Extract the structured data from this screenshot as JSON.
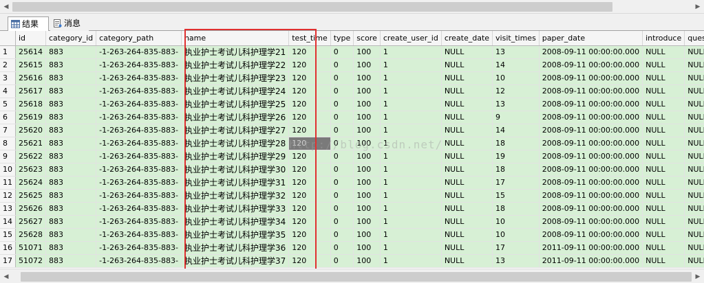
{
  "tabs": {
    "results_label": "结果",
    "messages_label": "消息"
  },
  "grid": {
    "columns": [
      "id",
      "category_id",
      "category_path",
      "name",
      "test_time",
      "type",
      "score",
      "create_user_id",
      "create_date",
      "visit_times",
      "paper_date",
      "introduce",
      "questio"
    ],
    "rows": [
      {
        "n": "1",
        "cells": [
          "25614",
          "883",
          "-1-263-264-835-883-",
          "执业护士考试儿科护理学21",
          "120",
          "0",
          "100",
          "1",
          "NULL",
          "13",
          "2008-09-11 00:00:00.000",
          "NULL",
          "NULL"
        ]
      },
      {
        "n": "2",
        "cells": [
          "25615",
          "883",
          "-1-263-264-835-883-",
          "执业护士考试儿科护理学22",
          "120",
          "0",
          "100",
          "1",
          "NULL",
          "14",
          "2008-09-11 00:00:00.000",
          "NULL",
          "NULL"
        ]
      },
      {
        "n": "3",
        "cells": [
          "25616",
          "883",
          "-1-263-264-835-883-",
          "执业护士考试儿科护理学23",
          "120",
          "0",
          "100",
          "1",
          "NULL",
          "10",
          "2008-09-11 00:00:00.000",
          "NULL",
          "NULL"
        ]
      },
      {
        "n": "4",
        "cells": [
          "25617",
          "883",
          "-1-263-264-835-883-",
          "执业护士考试儿科护理学24",
          "120",
          "0",
          "100",
          "1",
          "NULL",
          "12",
          "2008-09-11 00:00:00.000",
          "NULL",
          "NULL"
        ]
      },
      {
        "n": "5",
        "cells": [
          "25618",
          "883",
          "-1-263-264-835-883-",
          "执业护士考试儿科护理学25",
          "120",
          "0",
          "100",
          "1",
          "NULL",
          "13",
          "2008-09-11 00:00:00.000",
          "NULL",
          "NULL"
        ]
      },
      {
        "n": "6",
        "cells": [
          "25619",
          "883",
          "-1-263-264-835-883-",
          "执业护士考试儿科护理学26",
          "120",
          "0",
          "100",
          "1",
          "NULL",
          "9",
          "2008-09-11 00:00:00.000",
          "NULL",
          "NULL"
        ]
      },
      {
        "n": "7",
        "cells": [
          "25620",
          "883",
          "-1-263-264-835-883-",
          "执业护士考试儿科护理学27",
          "120",
          "0",
          "100",
          "1",
          "NULL",
          "14",
          "2008-09-11 00:00:00.000",
          "NULL",
          "NULL"
        ]
      },
      {
        "n": "8",
        "cells": [
          "25621",
          "883",
          "-1-263-264-835-883-",
          "执业护士考试儿科护理学28",
          "120",
          "0",
          "100",
          "1",
          "NULL",
          "18",
          "2008-09-11 00:00:00.000",
          "NULL",
          "NULL"
        ]
      },
      {
        "n": "9",
        "cells": [
          "25622",
          "883",
          "-1-263-264-835-883-",
          "执业护士考试儿科护理学29",
          "120",
          "0",
          "100",
          "1",
          "NULL",
          "19",
          "2008-09-11 00:00:00.000",
          "NULL",
          "NULL"
        ]
      },
      {
        "n": "10",
        "cells": [
          "25623",
          "883",
          "-1-263-264-835-883-",
          "执业护士考试儿科护理学30",
          "120",
          "0",
          "100",
          "1",
          "NULL",
          "18",
          "2008-09-11 00:00:00.000",
          "NULL",
          "NULL"
        ]
      },
      {
        "n": "11",
        "cells": [
          "25624",
          "883",
          "-1-263-264-835-883-",
          "执业护士考试儿科护理学31",
          "120",
          "0",
          "100",
          "1",
          "NULL",
          "17",
          "2008-09-11 00:00:00.000",
          "NULL",
          "NULL"
        ]
      },
      {
        "n": "12",
        "cells": [
          "25625",
          "883",
          "-1-263-264-835-883-",
          "执业护士考试儿科护理学32",
          "120",
          "0",
          "100",
          "1",
          "NULL",
          "15",
          "2008-09-11 00:00:00.000",
          "NULL",
          "NULL"
        ]
      },
      {
        "n": "13",
        "cells": [
          "25626",
          "883",
          "-1-263-264-835-883-",
          "执业护士考试儿科护理学33",
          "120",
          "0",
          "100",
          "1",
          "NULL",
          "18",
          "2008-09-11 00:00:00.000",
          "NULL",
          "NULL"
        ]
      },
      {
        "n": "14",
        "cells": [
          "25627",
          "883",
          "-1-263-264-835-883-",
          "执业护士考试儿科护理学34",
          "120",
          "0",
          "100",
          "1",
          "NULL",
          "10",
          "2008-09-11 00:00:00.000",
          "NULL",
          "NULL"
        ]
      },
      {
        "n": "15",
        "cells": [
          "25628",
          "883",
          "-1-263-264-835-883-",
          "执业护士考试儿科护理学35",
          "120",
          "0",
          "100",
          "1",
          "NULL",
          "10",
          "2008-09-11 00:00:00.000",
          "NULL",
          "NULL"
        ]
      },
      {
        "n": "16",
        "cells": [
          "51071",
          "883",
          "-1-263-264-835-883-",
          "执业护士考试儿科护理学36",
          "120",
          "0",
          "100",
          "1",
          "NULL",
          "17",
          "2011-09-11 00:00:00.000",
          "NULL",
          "NULL"
        ]
      },
      {
        "n": "17",
        "cells": [
          "51072",
          "883",
          "-1-263-264-835-883-",
          "执业护士考试儿科护理学37",
          "120",
          "0",
          "100",
          "1",
          "NULL",
          "13",
          "2011-09-11 00:00:00.000",
          "NULL",
          "NULL"
        ]
      }
    ],
    "selected_cell": {
      "row": 8,
      "column": "test_time"
    }
  },
  "watermark": "http://blog.csdn.net/"
}
